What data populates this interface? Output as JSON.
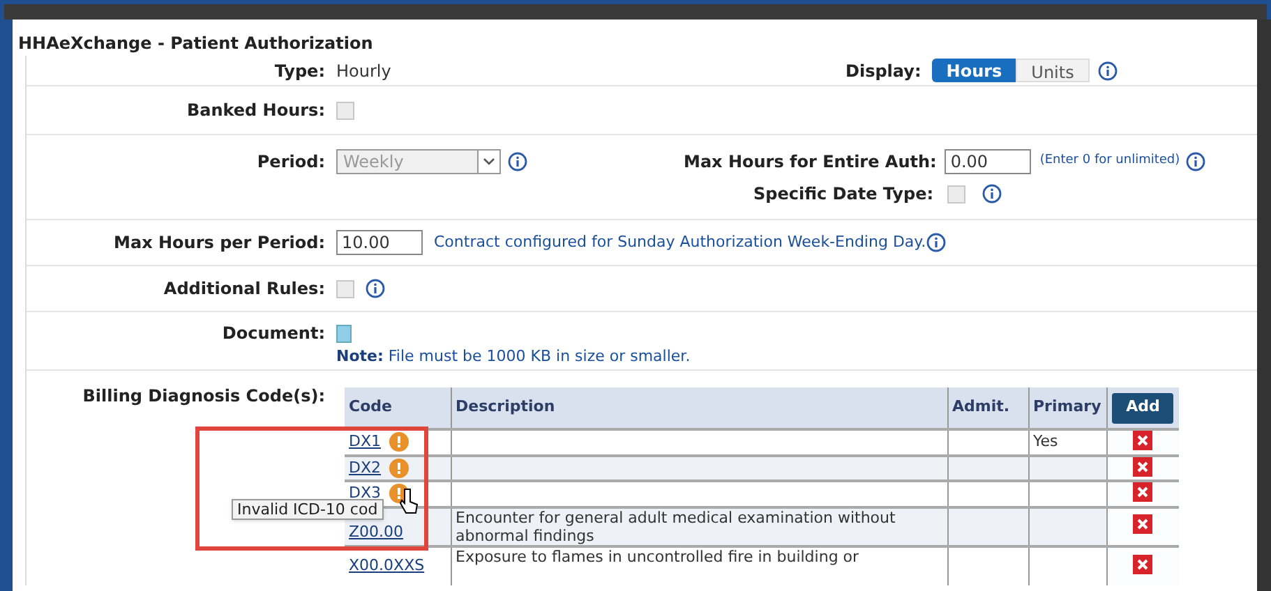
{
  "title": "HHAeXchange - Patient Authorization",
  "type": {
    "label": "Type:",
    "value": "Hourly"
  },
  "display": {
    "label": "Display:",
    "options": [
      {
        "label": "Hours",
        "selected": true
      },
      {
        "label": "Units",
        "selected": false
      }
    ]
  },
  "banked_hours": {
    "label": "Banked Hours:",
    "checked": false
  },
  "period": {
    "label": "Period:",
    "value": "Weekly"
  },
  "max_hours_entire_auth": {
    "label": "Max Hours for Entire Auth:",
    "value": "0.00",
    "hint": "(Enter 0 for unlimited)"
  },
  "specific_date_type": {
    "label": "Specific Date Type:",
    "checked": false
  },
  "max_hours_per_period": {
    "label": "Max Hours per Period:",
    "value": "10.00",
    "note": "Contract configured for Sunday Authorization Week-Ending Day."
  },
  "additional_rules": {
    "label": "Additional Rules:",
    "checked": false
  },
  "document": {
    "label": "Document:",
    "note": "**Note:** File must be 1000 KB in size or smaller."
  },
  "billing": {
    "label": "Billing Diagnosis Code(s):",
    "columns": [
      "Code",
      "Description",
      "Admit.",
      "Primary"
    ],
    "add_button": "Add",
    "rows": [
      {
        "code": "DX1",
        "warning": true,
        "description": "",
        "admit": "",
        "primary": "Yes"
      },
      {
        "code": "DX2",
        "warning": true,
        "description": "",
        "admit": "",
        "primary": ""
      },
      {
        "code": "DX3",
        "warning": true,
        "description": "",
        "admit": "",
        "primary": ""
      },
      {
        "code": "Z00.00",
        "warning": false,
        "description": "Encounter for general adult medical examination without abnormal findings",
        "admit": "",
        "primary": ""
      },
      {
        "code": "X00.0XXS",
        "warning": false,
        "description": "Exposure to flames in uncontrolled fire in building or",
        "admit": "",
        "primary": ""
      }
    ]
  },
  "tooltip": "Invalid ICD-10 cod"
}
